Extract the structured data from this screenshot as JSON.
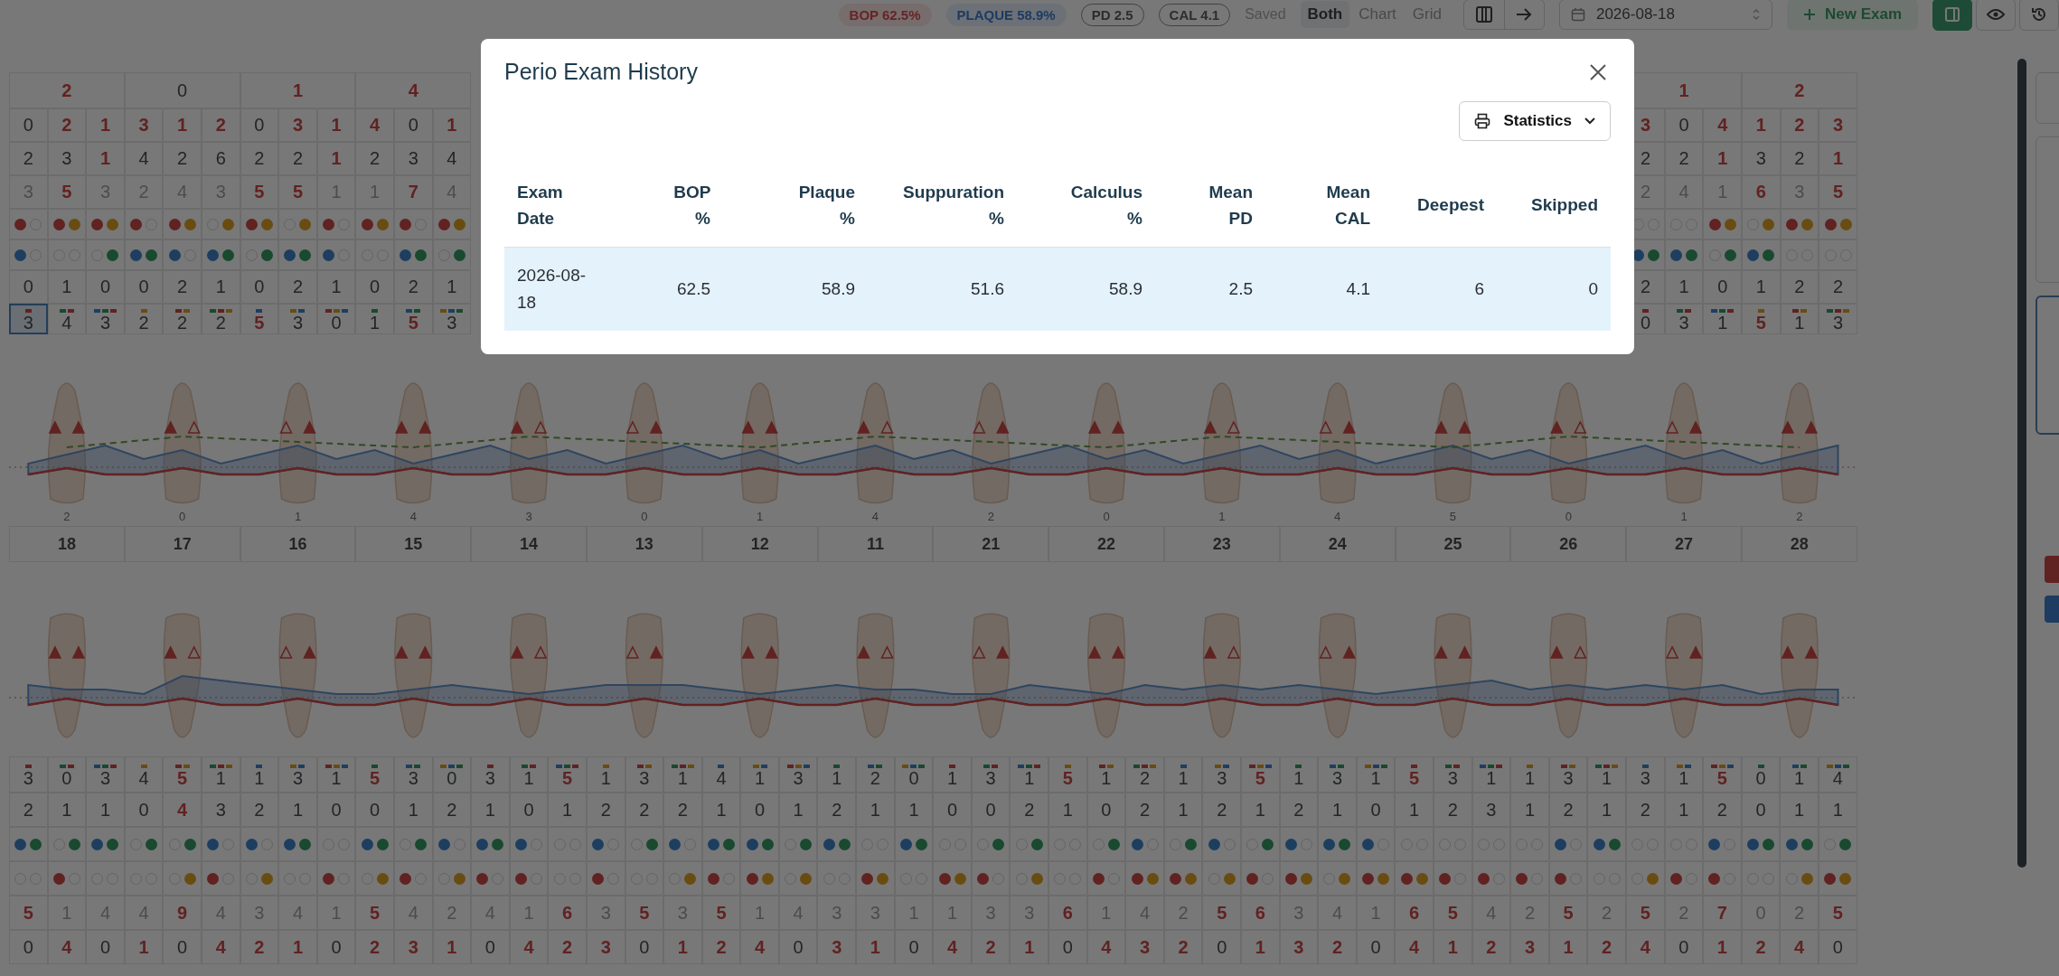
{
  "toolbar": {
    "bop": "BOP 62.5%",
    "plaque": "PLAQUE 58.9%",
    "pd": "PD 2.5",
    "cal": "CAL 4.1",
    "status": "Saved",
    "view_modes": [
      {
        "label": "Both",
        "selected": true
      },
      {
        "label": "Chart",
        "selected": false
      },
      {
        "label": "Grid",
        "selected": false
      }
    ],
    "date": {
      "value": "2026-08-18"
    },
    "new_exam": "New Exam",
    "panel_toggle": {
      "on": true
    }
  },
  "upper_grid": {
    "left": {
      "tooth_values": {
        "values": [
          "2",
          "0",
          "1",
          "4"
        ],
        "red": [
          true,
          false,
          true,
          true
        ]
      },
      "rows": [
        {
          "kind": "number",
          "muted": false,
          "values": [
            "0",
            "2",
            "1",
            "3",
            "1",
            "2",
            "0",
            "3",
            "1",
            "4",
            "0",
            "1"
          ],
          "red": [
            false,
            true,
            true,
            true,
            true,
            true,
            false,
            true,
            true,
            true,
            false,
            true
          ]
        },
        {
          "kind": "number",
          "muted": false,
          "values": [
            "2",
            "3",
            "1",
            "4",
            "2",
            "6",
            "2",
            "2",
            "1",
            "2",
            "3",
            "4"
          ],
          "red": [
            false,
            false,
            true,
            false,
            false,
            false,
            false,
            false,
            true,
            false,
            false,
            false
          ]
        },
        {
          "kind": "number",
          "muted": true,
          "values": [
            "3",
            "5",
            "3",
            "2",
            "4",
            "3",
            "5",
            "5",
            "1",
            "1",
            "7",
            "4"
          ],
          "red": [
            false,
            true,
            false,
            false,
            false,
            false,
            true,
            true,
            false,
            false,
            true,
            false
          ]
        },
        {
          "kind": "bleeding_suppuration",
          "first": [
            true,
            true,
            true,
            true,
            true,
            false,
            true,
            false,
            true,
            true,
            true,
            true
          ],
          "second": [
            false,
            true,
            true,
            false,
            true,
            true,
            true,
            true,
            false,
            true,
            false,
            true
          ]
        },
        {
          "kind": "plaque_calculus",
          "first": [
            true,
            false,
            false,
            true,
            true,
            true,
            false,
            true,
            true,
            false,
            true,
            false
          ],
          "second": [
            false,
            false,
            true,
            true,
            false,
            true,
            true,
            true,
            false,
            false,
            true,
            true
          ]
        },
        {
          "kind": "number",
          "muted": false,
          "values": [
            "0",
            "1",
            "0",
            "0",
            "2",
            "1",
            "0",
            "2",
            "1",
            "0",
            "2",
            "1"
          ],
          "red": [
            false,
            false,
            false,
            false,
            false,
            false,
            false,
            false,
            false,
            false,
            false,
            false
          ]
        },
        {
          "kind": "marked_number",
          "muted": false,
          "values": [
            "3",
            "4",
            "3",
            "2",
            "2",
            "2",
            "5",
            "3",
            "0",
            "1",
            "5",
            "3"
          ],
          "red": [
            false,
            false,
            false,
            false,
            false,
            false,
            true,
            false,
            false,
            false,
            true,
            false
          ],
          "selected": [
            true,
            false,
            false,
            false,
            false,
            false,
            false,
            false,
            false,
            false,
            false,
            false
          ]
        }
      ]
    },
    "right": {
      "tooth_values": {
        "values": [
          "1",
          "2"
        ],
        "red": [
          true,
          true
        ]
      },
      "rows": [
        {
          "kind": "number",
          "muted": false,
          "values": [
            "3",
            "0",
            "4",
            "1",
            "2",
            "3"
          ],
          "red": [
            true,
            false,
            true,
            true,
            true,
            true
          ]
        },
        {
          "kind": "number",
          "muted": false,
          "values": [
            "2",
            "2",
            "1",
            "3",
            "2",
            "1"
          ],
          "red": [
            false,
            false,
            true,
            false,
            false,
            true
          ]
        },
        {
          "kind": "number",
          "muted": true,
          "values": [
            "2",
            "4",
            "1",
            "6",
            "3",
            "5"
          ],
          "red": [
            false,
            false,
            false,
            true,
            false,
            true
          ]
        },
        {
          "kind": "bleeding_suppuration",
          "first": [
            false,
            false,
            true,
            false,
            true,
            true
          ],
          "second": [
            false,
            false,
            true,
            true,
            true,
            true
          ]
        },
        {
          "kind": "plaque_calculus",
          "first": [
            true,
            true,
            false,
            true,
            false,
            false
          ],
          "second": [
            true,
            true,
            true,
            true,
            false,
            false
          ]
        },
        {
          "kind": "number",
          "muted": false,
          "values": [
            "2",
            "1",
            "0",
            "1",
            "2",
            "2"
          ],
          "red": [
            false,
            false,
            false,
            false,
            false,
            false
          ]
        },
        {
          "kind": "marked_number",
          "muted": false,
          "values": [
            "0",
            "3",
            "1",
            "5",
            "1",
            "3"
          ],
          "red": [
            false,
            false,
            false,
            true,
            false,
            false
          ],
          "selected": [
            false,
            false,
            false,
            false,
            false,
            false
          ]
        }
      ]
    }
  },
  "upper_teeth": [
    {
      "number": "18",
      "value": "2"
    },
    {
      "number": "17",
      "value": "0"
    },
    {
      "number": "16",
      "value": "1"
    },
    {
      "number": "15",
      "value": "4"
    },
    {
      "number": "14",
      "value": "3"
    },
    {
      "number": "13",
      "value": "0"
    },
    {
      "number": "12",
      "value": "1"
    },
    {
      "number": "11",
      "value": "4"
    },
    {
      "number": "21",
      "value": "2"
    },
    {
      "number": "22",
      "value": "0"
    },
    {
      "number": "23",
      "value": "1"
    },
    {
      "number": "24",
      "value": "4"
    },
    {
      "number": "25",
      "value": "5"
    },
    {
      "number": "26",
      "value": "0"
    },
    {
      "number": "27",
      "value": "1"
    },
    {
      "number": "28",
      "value": "2"
    }
  ],
  "lower_grid": {
    "rows": [
      {
        "kind": "marked_number",
        "muted": false,
        "values": [
          "3",
          "0",
          "3",
          "4",
          "5",
          "1",
          "1",
          "3",
          "1",
          "5",
          "3",
          "0",
          "3",
          "1",
          "5",
          "1",
          "3",
          "1",
          "4",
          "1",
          "3",
          "1",
          "2",
          "0",
          "1",
          "3",
          "1",
          "5",
          "1",
          "2",
          "1",
          "3",
          "5",
          "1",
          "3",
          "1",
          "5",
          "3",
          "1",
          "1",
          "3",
          "1",
          "3",
          "1",
          "5",
          "0",
          "1",
          "4"
        ],
        "red": [
          false,
          false,
          false,
          false,
          true,
          false,
          false,
          false,
          false,
          true,
          false,
          false,
          false,
          false,
          true,
          false,
          false,
          false,
          false,
          false,
          false,
          false,
          false,
          false,
          false,
          false,
          false,
          true,
          false,
          false,
          false,
          false,
          true,
          false,
          false,
          false,
          true,
          false,
          false,
          false,
          false,
          false,
          false,
          false,
          true,
          false,
          false,
          false
        ]
      },
      {
        "kind": "number",
        "muted": false,
        "values": [
          "2",
          "1",
          "1",
          "0",
          "4",
          "3",
          "2",
          "1",
          "0",
          "0",
          "1",
          "2",
          "1",
          "0",
          "1",
          "2",
          "2",
          "2",
          "1",
          "0",
          "1",
          "2",
          "1",
          "1",
          "0",
          "0",
          "2",
          "1",
          "0",
          "2",
          "1",
          "2",
          "1",
          "2",
          "1",
          "0",
          "1",
          "2",
          "3",
          "1",
          "2",
          "1",
          "2",
          "1",
          "2",
          "0",
          "1",
          "1"
        ],
        "red": [
          false,
          false,
          false,
          false,
          true,
          false,
          false,
          false,
          false,
          false,
          false,
          false,
          false,
          false,
          false,
          false,
          false,
          false,
          false,
          false,
          false,
          false,
          false,
          false,
          false,
          false,
          false,
          false,
          false,
          false,
          false,
          false,
          false,
          false,
          false,
          false,
          false,
          false,
          false,
          false,
          false,
          false,
          false,
          false,
          false,
          false,
          false,
          false
        ]
      },
      {
        "kind": "plaque_calculus",
        "first": [
          true,
          false,
          true,
          false,
          false,
          true,
          true,
          true,
          false,
          true,
          false,
          true,
          true,
          true,
          false,
          true,
          false,
          true,
          true,
          true,
          false,
          true,
          false,
          true,
          false,
          false,
          false,
          false,
          false,
          true,
          false,
          true,
          false,
          true,
          true,
          true,
          false,
          false,
          false,
          false,
          true,
          true,
          false,
          false,
          true,
          true,
          true,
          false
        ],
        "second": [
          true,
          true,
          true,
          true,
          true,
          false,
          false,
          true,
          false,
          true,
          true,
          false,
          true,
          false,
          false,
          false,
          true,
          false,
          true,
          true,
          true,
          true,
          false,
          true,
          false,
          true,
          true,
          false,
          true,
          false,
          true,
          false,
          true,
          false,
          true,
          false,
          false,
          false,
          false,
          false,
          false,
          true,
          false,
          false,
          false,
          true,
          true,
          true
        ]
      },
      {
        "kind": "bleeding_suppuration",
        "first": [
          false,
          true,
          false,
          false,
          false,
          true,
          false,
          false,
          true,
          false,
          true,
          false,
          true,
          true,
          false,
          true,
          false,
          false,
          true,
          true,
          false,
          false,
          true,
          false,
          true,
          true,
          false,
          false,
          true,
          true,
          true,
          false,
          true,
          true,
          false,
          true,
          true,
          true,
          true,
          true,
          true,
          false,
          false,
          true,
          true,
          false,
          false,
          true
        ],
        "second": [
          false,
          false,
          false,
          false,
          true,
          false,
          true,
          false,
          false,
          true,
          false,
          true,
          false,
          false,
          false,
          false,
          false,
          true,
          false,
          true,
          true,
          false,
          true,
          false,
          true,
          false,
          true,
          false,
          false,
          true,
          true,
          true,
          false,
          true,
          true,
          true,
          true,
          false,
          false,
          false,
          false,
          false,
          true,
          false,
          false,
          false,
          true,
          true
        ]
      },
      {
        "kind": "number",
        "muted": true,
        "values": [
          "5",
          "1",
          "4",
          "4",
          "9",
          "4",
          "3",
          "4",
          "1",
          "5",
          "4",
          "2",
          "4",
          "1",
          "6",
          "3",
          "5",
          "3",
          "5",
          "1",
          "4",
          "3",
          "3",
          "1",
          "1",
          "3",
          "3",
          "6",
          "1",
          "4",
          "2",
          "5",
          "6",
          "3",
          "4",
          "1",
          "6",
          "5",
          "4",
          "2",
          "5",
          "2",
          "5",
          "2",
          "7",
          "0",
          "2",
          "5"
        ],
        "red": [
          true,
          false,
          false,
          false,
          true,
          false,
          false,
          false,
          false,
          true,
          false,
          false,
          false,
          false,
          true,
          false,
          true,
          false,
          true,
          false,
          false,
          false,
          false,
          false,
          false,
          false,
          false,
          true,
          false,
          false,
          false,
          true,
          true,
          false,
          false,
          false,
          true,
          true,
          false,
          false,
          true,
          false,
          true,
          false,
          true,
          false,
          false,
          true
        ]
      },
      {
        "kind": "number",
        "muted": false,
        "values": [
          "0",
          "4",
          "0",
          "1",
          "0",
          "4",
          "2",
          "1",
          "0",
          "2",
          "3",
          "1",
          "0",
          "4",
          "2",
          "3",
          "0",
          "1",
          "2",
          "4",
          "0",
          "3",
          "1",
          "0",
          "4",
          "2",
          "1",
          "0",
          "4",
          "3",
          "2",
          "0",
          "1",
          "3",
          "2",
          "0",
          "4",
          "1",
          "2",
          "3",
          "1",
          "2",
          "4",
          "0",
          "1",
          "2",
          "4",
          "0"
        ],
        "red": [
          false,
          true,
          false,
          true,
          false,
          true,
          true,
          true,
          false,
          true,
          true,
          true,
          false,
          true,
          true,
          true,
          false,
          true,
          true,
          true,
          false,
          true,
          true,
          false,
          true,
          true,
          true,
          false,
          true,
          true,
          true,
          false,
          true,
          true,
          true,
          false,
          true,
          true,
          true,
          true,
          true,
          true,
          true,
          false,
          true,
          true,
          true,
          false
        ]
      }
    ]
  },
  "side_tabs": [
    {
      "selected": false
    },
    {
      "selected": false
    },
    {
      "selected": true
    }
  ],
  "modal": {
    "title": "Perio Exam History",
    "statistics_button": "Statistics",
    "columns": [
      "Exam Date",
      "BOP %",
      "Plaque %",
      "Suppuration %",
      "Calculus %",
      "Mean PD",
      "Mean CAL",
      "Deepest",
      "Skipped"
    ],
    "rows": [
      {
        "selected": true,
        "cells": [
          "2026-08-18",
          "62.5",
          "58.9",
          "51.6",
          "58.9",
          "2.5",
          "4.1",
          "6",
          "0"
        ]
      }
    ]
  }
}
